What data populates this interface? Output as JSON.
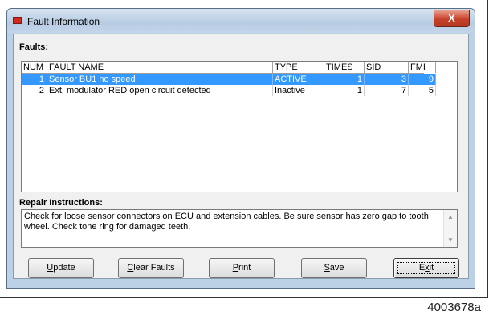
{
  "window": {
    "title": "Fault Information",
    "close_glyph": "X"
  },
  "faults": {
    "label": "Faults:",
    "columns": [
      "NUM",
      "FAULT NAME",
      "TYPE",
      "TIMES",
      "SID",
      "FMI"
    ],
    "rows": [
      {
        "num": "1",
        "name": "Sensor BU1 no speed",
        "type": "ACTIVE",
        "times": "1",
        "sid": "3",
        "fmi": "9",
        "selected": true
      },
      {
        "num": "2",
        "name": "Ext. modulator RED open circuit detected",
        "type": "Inactive",
        "times": "1",
        "sid": "7",
        "fmi": "5",
        "selected": false
      }
    ]
  },
  "repair": {
    "label": "Repair Instructions:",
    "text": "Check for loose sensor connectors on ECU and extension cables. Be sure sensor has zero gap to tooth wheel. Check tone ring for damaged teeth."
  },
  "buttons": {
    "update": {
      "first": "U",
      "rest": "pdate"
    },
    "clear": {
      "first": "C",
      "rest": "lear Faults"
    },
    "print": {
      "first": "P",
      "rest": "rint"
    },
    "save": {
      "first": "S",
      "rest": "ave"
    },
    "exit": {
      "pre": "E",
      "ul": "x",
      "post": "it"
    }
  },
  "figure_id": "4003678a",
  "colors": {
    "selection": "#3399ff",
    "title_icon": "#d02a1f",
    "close_button": "#c7402a"
  }
}
